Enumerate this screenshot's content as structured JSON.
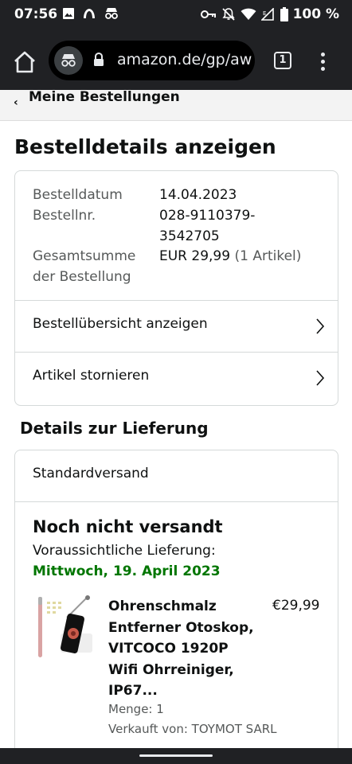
{
  "status_bar": {
    "time": "07:56",
    "battery": "100 %",
    "icons_left": [
      "image-icon",
      "arc-icon",
      "incognito-icon"
    ],
    "icons_right": [
      "key-icon",
      "bell-off-icon",
      "wifi-icon",
      "signal-icon",
      "battery-icon"
    ]
  },
  "browser": {
    "url": "amazon.de/gp/aw",
    "tab_count": "1"
  },
  "breadcrumb": {
    "label": "Meine Bestellungen"
  },
  "page": {
    "title": "Bestelldetails anzeigen"
  },
  "order": {
    "date_label": "Bestelldatum",
    "date_value": "14.04.2023",
    "number_label": "Bestellnr.",
    "number_value_line1": "028-9110379-",
    "number_value_line2": "3542705",
    "total_label_line1": "Gesamtsumme",
    "total_label_line2": "der Bestellung",
    "total_value": "EUR 29,99",
    "total_items": "(1 Artikel)",
    "links": [
      {
        "label": "Bestellübersicht anzeigen"
      },
      {
        "label": "Artikel stornieren"
      }
    ]
  },
  "delivery": {
    "section_title": "Details zur Lieferung",
    "shipping_method": "Standardversand",
    "status": "Noch nicht versandt",
    "expected_label": "Voraussichtliche Lieferung:",
    "expected_date": "Mittwoch, 19. April 2023",
    "product": {
      "title_lines": [
        "Ohrenschmalz",
        "Entferner Otoskop,",
        "VITCOCO 1920P",
        "Wifi Ohrreiniger,",
        "IP67..."
      ],
      "price": "€29,99",
      "quantity": "Menge: 1",
      "seller": "Verkauft von: TOYMOT SARL"
    }
  },
  "colors": {
    "delivery_date": "#007600",
    "chrome_bar": "#202124",
    "border": "#d5d9d9"
  }
}
